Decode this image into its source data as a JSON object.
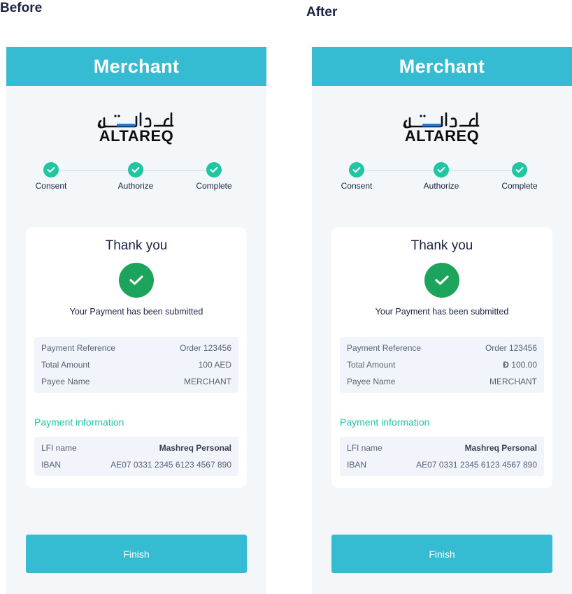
{
  "labels": {
    "before": "Before",
    "after": "After"
  },
  "before": {
    "header_title": "Merchant",
    "logo_text": "ALTAREQ",
    "steps": [
      "Consent",
      "Authorize",
      "Complete"
    ],
    "thank_you": "Thank you",
    "submitted_msg": "Your Payment has been submitted",
    "summary": [
      {
        "label": "Payment Reference",
        "value": "Order 123456"
      },
      {
        "label": "Total Amount",
        "value": "100 AED"
      },
      {
        "label": "Payee Name",
        "value": "MERCHANT"
      }
    ],
    "payment_info_title": "Payment information",
    "payment_info": [
      {
        "label": "LFI name",
        "value": "Mashreq Personal"
      },
      {
        "label": "IBAN",
        "value": "AE07 0331 2345 6123 4567 890"
      }
    ],
    "finish_label": "Finish"
  },
  "after": {
    "header_title": "Merchant",
    "logo_text": "ALTAREQ",
    "steps": [
      "Consent",
      "Authorize",
      "Complete"
    ],
    "thank_you": "Thank you",
    "submitted_msg": "Your Payment has been submitted",
    "summary": [
      {
        "label": "Payment Reference",
        "value": "Order 123456"
      },
      {
        "label": "Total Amount",
        "value": "100.00",
        "currency_symbol": "Đ"
      },
      {
        "label": "Payee Name",
        "value": "MERCHANT"
      }
    ],
    "payment_info_title": "Payment information",
    "payment_info": [
      {
        "label": "LFI name",
        "value": "Mashreq Personal"
      },
      {
        "label": "IBAN",
        "value": "AE07 0331 2345 6123 4567 890"
      }
    ],
    "finish_label": "Finish"
  },
  "colors": {
    "header": "#35bcd3",
    "step_check": "#20c6a2",
    "success": "#1ca35c",
    "accent_text": "#22c3aa",
    "button": "#35bcd3",
    "background": "#f4f7fa"
  },
  "icons": {
    "step": "check-circle-icon",
    "success": "check-circle-large-icon"
  }
}
